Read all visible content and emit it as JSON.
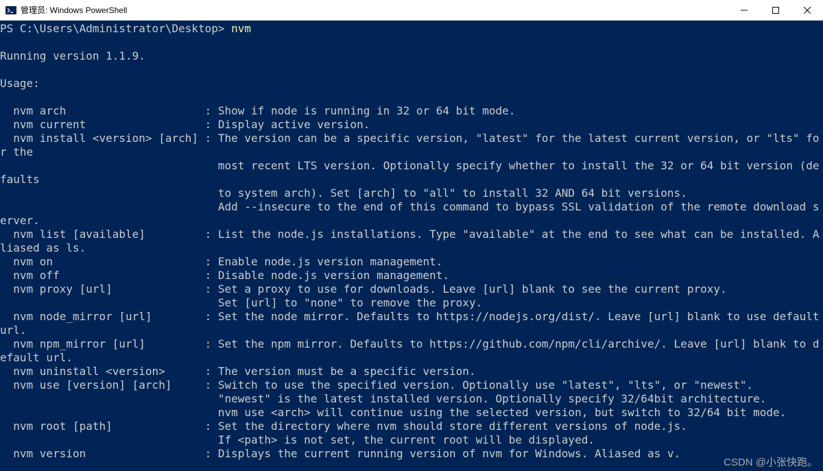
{
  "window": {
    "title": "管理员: Windows PowerShell",
    "icon_name": "powershell-icon"
  },
  "terminal": {
    "prompt": "PS C:\\Users\\Administrator\\Desktop> ",
    "command": "nvm",
    "output": "\nRunning version 1.1.9.\n\nUsage:\n\n  nvm arch                     : Show if node is running in 32 or 64 bit mode.\n  nvm current                  : Display active version.\n  nvm install <version> [arch] : The version can be a specific version, \"latest\" for the latest current version, or \"lts\" for the\n                                 most recent LTS version. Optionally specify whether to install the 32 or 64 bit version (defaults\n                                 to system arch). Set [arch] to \"all\" to install 32 AND 64 bit versions.\n                                 Add --insecure to the end of this command to bypass SSL validation of the remote download server.\n  nvm list [available]         : List the node.js installations. Type \"available\" at the end to see what can be installed. Aliased as ls.\n  nvm on                       : Enable node.js version management.\n  nvm off                      : Disable node.js version management.\n  nvm proxy [url]              : Set a proxy to use for downloads. Leave [url] blank to see the current proxy.\n                                 Set [url] to \"none\" to remove the proxy.\n  nvm node_mirror [url]        : Set the node mirror. Defaults to https://nodejs.org/dist/. Leave [url] blank to use default url.\n  nvm npm_mirror [url]         : Set the npm mirror. Defaults to https://github.com/npm/cli/archive/. Leave [url] blank to default url.\n  nvm uninstall <version>      : The version must be a specific version.\n  nvm use [version] [arch]     : Switch to use the specified version. Optionally use \"latest\", \"lts\", or \"newest\".\n                                 \"newest\" is the latest installed version. Optionally specify 32/64bit architecture.\n                                 nvm use <arch> will continue using the selected version, but switch to 32/64 bit mode.\n  nvm root [path]              : Set the directory where nvm should store different versions of node.js.\n                                 If <path> is not set, the current root will be displayed.\n  nvm version                  : Displays the current running version of nvm for Windows. Aliased as v."
  },
  "watermark": "CSDN @小张快跑。"
}
